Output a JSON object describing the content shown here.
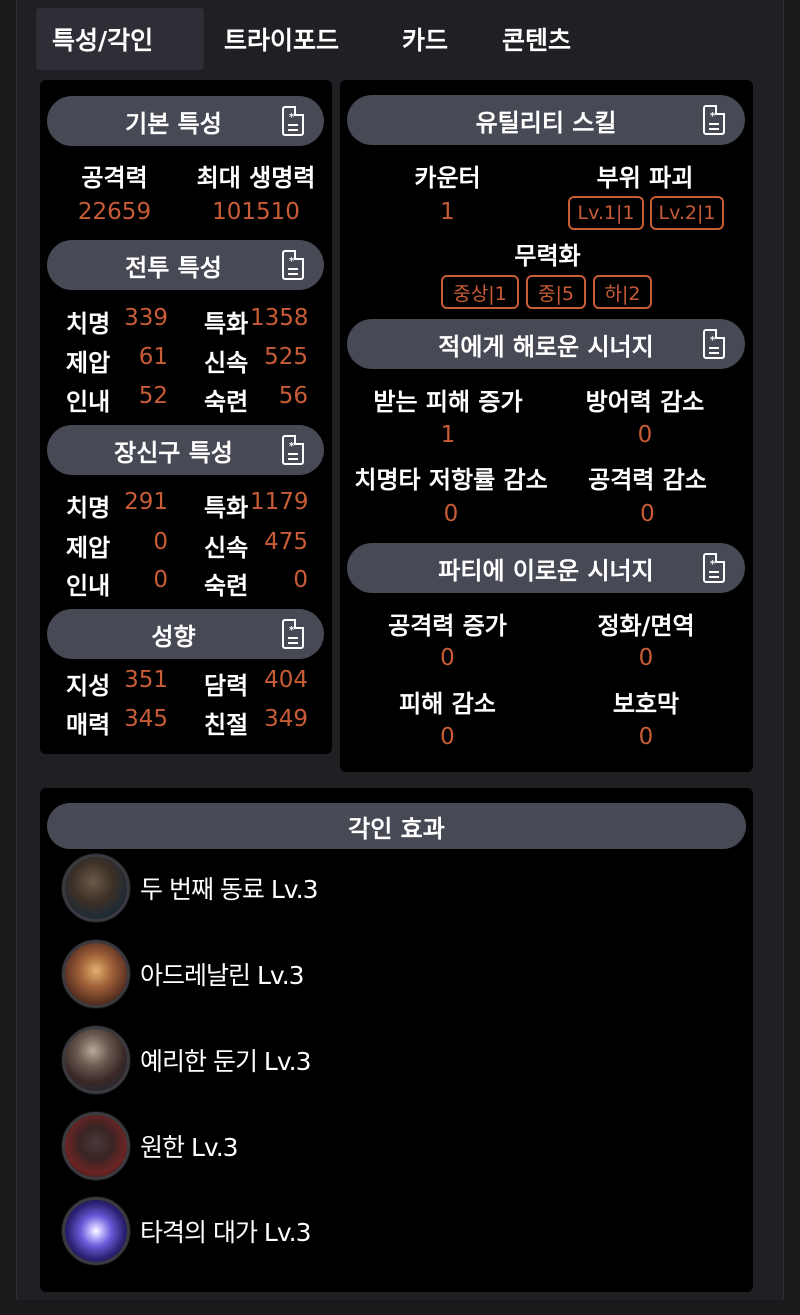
{
  "tabs": [
    "특성/각인",
    "트라이포드",
    "카드",
    "콘텐츠"
  ],
  "basic": {
    "title": "기본 특성",
    "attack_label": "공격력",
    "attack_value": "22659",
    "hp_label": "최대 생명력",
    "hp_value": "101510"
  },
  "combat": {
    "title": "전투 특성",
    "stats": [
      {
        "label": "치명",
        "value": "339"
      },
      {
        "label": "특화",
        "value": "1358"
      },
      {
        "label": "제압",
        "value": "61"
      },
      {
        "label": "신속",
        "value": "525"
      },
      {
        "label": "인내",
        "value": "52"
      },
      {
        "label": "숙련",
        "value": "56"
      }
    ]
  },
  "accessory": {
    "title": "장신구 특성",
    "stats": [
      {
        "label": "치명",
        "value": "291"
      },
      {
        "label": "특화",
        "value": "1179"
      },
      {
        "label": "제압",
        "value": "0"
      },
      {
        "label": "신속",
        "value": "475"
      },
      {
        "label": "인내",
        "value": "0"
      },
      {
        "label": "숙련",
        "value": "0"
      }
    ]
  },
  "tendency": {
    "title": "성향",
    "stats": [
      {
        "label": "지성",
        "value": "351"
      },
      {
        "label": "담력",
        "value": "404"
      },
      {
        "label": "매력",
        "value": "345"
      },
      {
        "label": "친절",
        "value": "349"
      }
    ]
  },
  "utility": {
    "title": "유틸리티 스킬",
    "counter_label": "카운터",
    "counter_value": "1",
    "destroy_label": "부위 파괴",
    "destroy_tags": [
      "Lv.1|1",
      "Lv.2|1"
    ],
    "neutralize_label": "무력화",
    "neutralize_tags": [
      "중상|1",
      "중|5",
      "하|2"
    ]
  },
  "enemy_synergy": {
    "title": "적에게 해로운 시너지",
    "items": [
      {
        "label": "받는 피해 증가",
        "value": "1"
      },
      {
        "label": "방어력 감소",
        "value": "0"
      },
      {
        "label": "치명타 저항률 감소",
        "value": "0"
      },
      {
        "label": "공격력 감소",
        "value": "0"
      }
    ]
  },
  "party_synergy": {
    "title": "파티에 이로운 시너지",
    "items": [
      {
        "label": "공격력 증가",
        "value": "0"
      },
      {
        "label": "정화/면역",
        "value": "0"
      },
      {
        "label": "피해 감소",
        "value": "0"
      },
      {
        "label": "보호막",
        "value": "0"
      }
    ]
  },
  "engravings": {
    "title": "각인 효과",
    "items": [
      {
        "name": "두 번째 동료 Lv.3",
        "icon": "dragon-companion-icon"
      },
      {
        "name": "아드레날린 Lv.3",
        "icon": "adrenaline-icon"
      },
      {
        "name": "예리한 둔기 Lv.3",
        "icon": "blunt-weapon-icon"
      },
      {
        "name": "원한 Lv.3",
        "icon": "grudge-beast-icon"
      },
      {
        "name": "타격의 대가 Lv.3",
        "icon": "hit-master-icon"
      }
    ]
  },
  "colors": {
    "accent": "#c85c36",
    "pill": "#474955",
    "panel": "#000000",
    "background": "#202024"
  }
}
